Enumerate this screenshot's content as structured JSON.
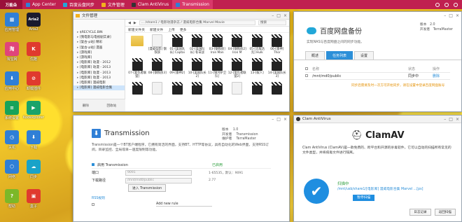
{
  "taskbar": {
    "logo": "万能朵",
    "tasks": [
      {
        "label": "App Center",
        "color": "#2f7fd6"
      },
      {
        "label": "百度云盘同步",
        "color": "#22a7d8"
      },
      {
        "label": "文件管理",
        "color": "#f2b01e"
      },
      {
        "label": "Clam AntiVirus",
        "color": "#333333"
      },
      {
        "label": "Transmission",
        "color": "#2f7fd6"
      }
    ]
  },
  "desktop_icons": [
    {
      "label": "应用管理",
      "color": "#2f7fd6",
      "glyph": "▦"
    },
    {
      "label": "Aria2",
      "color": "#1a1a2e",
      "glyph": "Aria2"
    },
    {
      "label": "淘宝网",
      "color": "#e0457b",
      "glyph": "淘"
    },
    {
      "label": "优酷",
      "color": "#e03a2e",
      "glyph": "K"
    },
    {
      "label": "应用中心",
      "color": "#2f7fd6",
      "glyph": "⬇"
    },
    {
      "label": "卸载插件",
      "color": "#e03a2e",
      "glyph": "⊘"
    },
    {
      "label": "系统设置",
      "color": "#17a35a",
      "glyph": "≡"
    },
    {
      "label": "Kodexplorer",
      "color": "#1aa36a",
      "glyph": "▶"
    },
    {
      "label": "关机",
      "color": "#2f7fd6",
      "glyph": "◷"
    },
    {
      "label": "下载",
      "color": "#2f7fd6",
      "glyph": "⬇"
    },
    {
      "label": "网络",
      "color": "#2f7fd6",
      "glyph": "⬡"
    },
    {
      "label": "同步",
      "color": "#1aa3c8",
      "glyph": "☁"
    },
    {
      "label": "帮助",
      "color": "#7cb828",
      "glyph": "?"
    },
    {
      "label": "盒子",
      "color": "#e03a2e",
      "glyph": "▣"
    }
  ],
  "file_manager": {
    "title": "文件管理",
    "path": "... /share1 / 电影动漫杂志 / 漫威电影合集 Marvel Movie",
    "search": "搜索",
    "actions": [
      "新建文件夹",
      "新建文件",
      "上传",
      "更多"
    ],
    "tree": [
      "$RECYCLE.BIN",
      "[我电影与电视剧实录]",
      "[复古-p站] 精彩",
      "[复古-p站] 漫画",
      "[游戏库]",
      "[游戏库]",
      "[电影库] 动漫 - 2012",
      "[电影库] 动漫 - 2013",
      "[电影库] 动漫 - 2013",
      "[电影库] 动漫 - 2013",
      "[电影库] 漫威电影",
      "[电影库] 漫威电影合集"
    ],
    "bottom": [
      "删除",
      "回收站"
    ],
    "items": [
      {
        "label": "",
        "kind": "folder"
      },
      {
        "label": "[漫威电影] 钢铁侠",
        "kind": "doc"
      },
      {
        "label": "01-[美国队长] Captai",
        "kind": "clap"
      },
      {
        "label": "02-[美国队长] 冬日战",
        "kind": "clap"
      },
      {
        "label": "03-[钢铁侠] Iron Man",
        "kind": "clap"
      },
      {
        "label": "04-[钢铁侠2] Iron M",
        "kind": "clap"
      },
      {
        "label": "05-[无敌浩克] Hulk",
        "kind": "clap"
      },
      {
        "label": "06-[雷神] Thor",
        "kind": "clap"
      },
      {
        "label": "07-[复仇者联盟]",
        "kind": "clap"
      },
      {
        "label": "08-[钢铁侠3]",
        "kind": "clap"
      },
      {
        "label": "09-[雷神2]",
        "kind": "clap"
      },
      {
        "label": "10-[美国队长2]",
        "kind": "clap"
      },
      {
        "label": "11-[银河护卫队]",
        "kind": "clap"
      },
      {
        "label": "12-[复仇者联盟2]",
        "kind": "clap"
      },
      {
        "label": "13-[蚁人]",
        "kind": "clap"
      },
      {
        "label": "14-[美国队长3]",
        "kind": "clap"
      },
      {
        "label": "",
        "kind": "clap"
      },
      {
        "label": "",
        "kind": "doc"
      },
      {
        "label": "",
        "kind": "clap"
      },
      {
        "label": "",
        "kind": "clap"
      },
      {
        "label": "",
        "kind": "clap"
      },
      {
        "label": "",
        "kind": "doc"
      },
      {
        "label": "",
        "kind": "clap"
      },
      {
        "label": "",
        "kind": "clap"
      }
    ]
  },
  "baidu": {
    "title": "百度网盘备份",
    "meta": [
      "版本",
      "2.0",
      "开发者",
      "TerraMaster"
    ],
    "desc": "实现NAS与百度网盘之间的同步功能。",
    "tabs": [
      "概述",
      "任务列表",
      "设置"
    ],
    "table_header": [
      "名称",
      "状态",
      "操作"
    ],
    "row": [
      "/mnt/md0/public",
      "同步中",
      "删除"
    ],
    "note": "同步后需要及时一次方可开始同步，请在设置中登录百度网盘账号"
  },
  "transmission": {
    "title": "Transmission",
    "meta": [
      "版本",
      "1.0",
      "开发者",
      "Transmission",
      "维护者",
      "TerraMaster"
    ],
    "desc": "Transmission是一个BT客户端程序，它拥有简洁的界面，支持BT、HTTP等协议，具有自动化的Web界面，支持RSS订阅，目录监控、全局或单一速度限制等功能。",
    "enable": "启用 Transmission",
    "status": "已启用",
    "port_label": "端口",
    "port_value": "9091",
    "port_hint": "1-65535，默认：9091",
    "dir_label": "下载路径",
    "dir_value": "/mnt/md0/public",
    "version_hint": "2.77",
    "button": "进入 Transmission",
    "rss": "RSS规则",
    "rss_add": "Add new rule"
  },
  "clamav": {
    "title": "Clam AntiVirus",
    "logo": "ClamAV",
    "desc": "Clam AntiVirus (ClamAV)是一款免费的、跨平台和开源的杀毒软件，它可以自动的扫描所有常见的文件类型，并将病毒文件进行隔离。",
    "status": "扫描中",
    "path": "/mnt/usb/share1/[电影库] 漫威电影合集 Marvel ...[ps]",
    "button": "暂停扫描",
    "foot": [
      "日志记录",
      "返回扫描"
    ]
  }
}
